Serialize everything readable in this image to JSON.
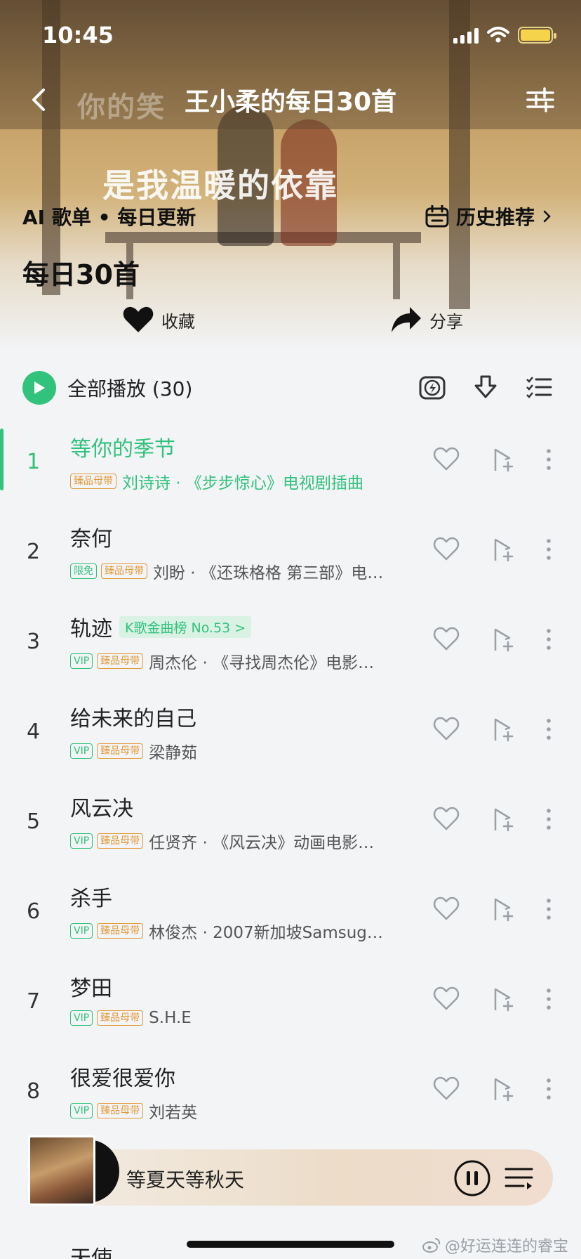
{
  "status_bar": {
    "time": "10:45"
  },
  "header": {
    "title": "王小柔的每日30首",
    "hero_line1": "你的笑",
    "hero_line2": "是我温暖的依靠",
    "meta": "AI 歌单 • 每日更新",
    "history_label": "历史推荐",
    "list_title": "每日30首",
    "favorite_label": "收藏",
    "share_label": "分享"
  },
  "play_all": {
    "label": "全部播放",
    "count": "(30)"
  },
  "songs": [
    {
      "num": "1",
      "title": "等你的季节",
      "tags": [
        "臻品母带"
      ],
      "artist": "刘诗诗 · 《步步惊心》电视剧插曲"
    },
    {
      "num": "2",
      "title": "奈何",
      "tags": [
        "限免",
        "臻品母带"
      ],
      "artist": "刘盼 · 《还珠格格 第三部》电…"
    },
    {
      "num": "3",
      "title": "轨迹",
      "rank": "K歌金曲榜 No.53 >",
      "tags": [
        "VIP",
        "臻品母带"
      ],
      "artist": "周杰伦 · 《寻找周杰伦》电影…"
    },
    {
      "num": "4",
      "title": "给未来的自己",
      "tags": [
        "VIP",
        "臻品母带"
      ],
      "artist": "梁静茹"
    },
    {
      "num": "5",
      "title": "风云决",
      "tags": [
        "VIP",
        "臻品母带"
      ],
      "artist": "任贤齐 · 《风云决》动画电影…"
    },
    {
      "num": "6",
      "title": "杀手",
      "tags": [
        "VIP",
        "臻品母带"
      ],
      "artist": "林俊杰 · 2007新加坡Samsug…"
    },
    {
      "num": "7",
      "title": "梦田",
      "tags": [
        "VIP",
        "臻品母带"
      ],
      "artist": "S.H.E"
    },
    {
      "num": "8",
      "title": "很爱很爱你",
      "tags": [
        "VIP",
        "臻品母带"
      ],
      "artist": "刘若英"
    }
  ],
  "mini_player": {
    "title": "等夏天等秋天"
  },
  "next_peek": "天使",
  "watermark": "@好运连连的睿宝",
  "colors": {
    "accent": "#31c27c",
    "hq_tag": "#e39a3b"
  }
}
